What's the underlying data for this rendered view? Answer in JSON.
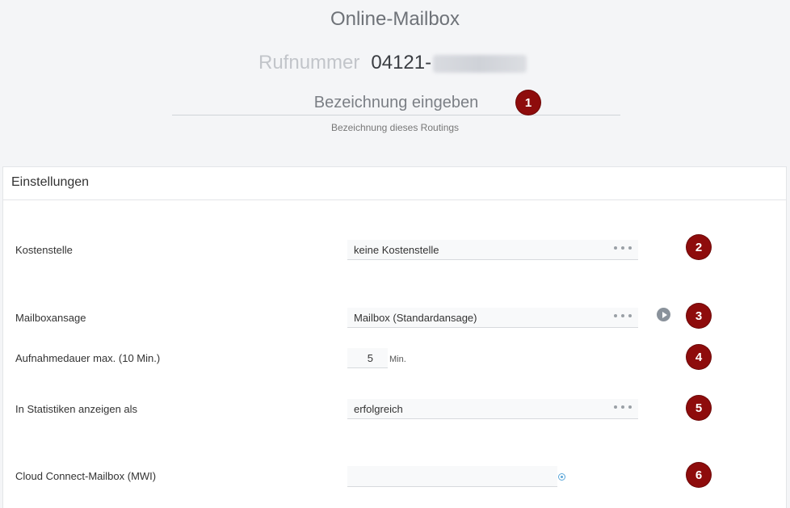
{
  "header": {
    "title": "Online-Mailbox",
    "phone_label": "Rufnummer",
    "phone_prefix": "04121-",
    "name_placeholder": "Bezeichnung eingeben",
    "name_hint": "Bezeichnung dieses Routings"
  },
  "markers": [
    "1",
    "2",
    "3",
    "4",
    "5",
    "6"
  ],
  "settings": {
    "title": "Einstellungen",
    "cost_center": {
      "label": "Kostenstelle",
      "value": "keine Kostenstelle"
    },
    "mailbox_greeting": {
      "label": "Mailboxansage",
      "value": "Mailbox (Standardansage)"
    },
    "recording_duration": {
      "label": "Aufnahmedauer max. (10 Min.)",
      "value": "5",
      "unit": "Min."
    },
    "statistics": {
      "label": "In Statistiken anzeigen als",
      "value": "erfolgreich"
    },
    "cloud_connect": {
      "label": "Cloud Connect-Mailbox (MWI)",
      "value": ""
    }
  }
}
